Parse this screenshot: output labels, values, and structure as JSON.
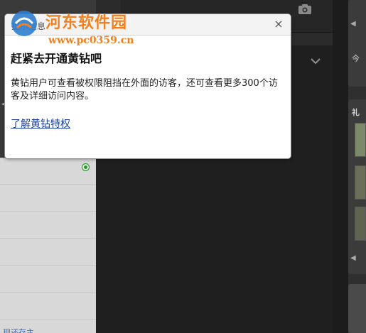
{
  "watermark": {
    "title": "河东软件园",
    "url": "www.pc0359.cn"
  },
  "dialog": {
    "title": "提示信息",
    "close_symbol": "×",
    "heading": "赶紧去开通黄钻吧",
    "body": "黄钻用户可查看被权限阻挡在外面的访客，还可查看更多300个访客及详细访问内容。",
    "link": "了解黄钻特权"
  },
  "background": {
    "right_panel_top_text": "今",
    "right_panel_section_text": "礼",
    "bottom_link_text": "现还存主"
  },
  "colors": {
    "watermark": "#f08020",
    "link": "#1a3d9a",
    "status_dot": "#2a9a2a"
  }
}
